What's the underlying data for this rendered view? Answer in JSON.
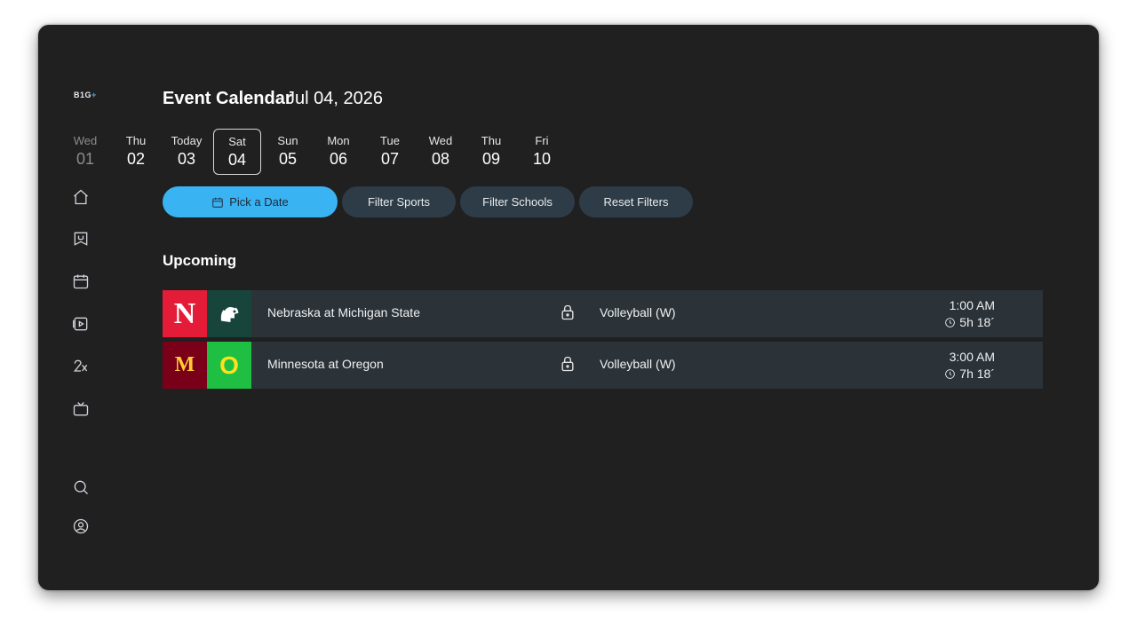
{
  "app": {
    "logo_text": "B1G",
    "logo_plus": "+"
  },
  "header": {
    "title": "Event Calendar",
    "date": "Jul 04, 2026"
  },
  "days": [
    {
      "name": "Wed",
      "num": "01"
    },
    {
      "name": "Thu",
      "num": "02"
    },
    {
      "name": "Today",
      "num": "03"
    },
    {
      "name": "Sat",
      "num": "04"
    },
    {
      "name": "Sun",
      "num": "05"
    },
    {
      "name": "Mon",
      "num": "06"
    },
    {
      "name": "Tue",
      "num": "07"
    },
    {
      "name": "Wed",
      "num": "08"
    },
    {
      "name": "Thu",
      "num": "09"
    },
    {
      "name": "Fri",
      "num": "10"
    }
  ],
  "filters": {
    "pick_date": "Pick a Date",
    "sports": "Filter Sports",
    "schools": "Filter Schools",
    "reset": "Reset Filters"
  },
  "section_title": "Upcoming",
  "events": [
    {
      "home_logo_text": "N",
      "away_logo_text": "",
      "matchup": "Nebraska at Michigan State",
      "sport": "Volleyball (W)",
      "time": "1:00 AM",
      "countdown": "5h 18´"
    },
    {
      "home_logo_text": "M",
      "away_logo_text": "O",
      "matchup": "Minnesota at Oregon",
      "sport": "Volleyball (W)",
      "time": "3:00 AM",
      "countdown": "7h 18´"
    }
  ],
  "nav": [
    "home-icon",
    "bracket-icon",
    "calendar-icon",
    "video-icon",
    "scores-icon",
    "tv-icon",
    "search-icon",
    "profile-icon"
  ],
  "colors": {
    "background": "#202021",
    "accent": "#3ab3f3",
    "pill": "#2e3c47",
    "row": "#2b3339",
    "nebraska": "#e41c38",
    "michigan_state": "#18453b",
    "minnesota": "#7a0019",
    "oregon": "#1fbf43"
  }
}
